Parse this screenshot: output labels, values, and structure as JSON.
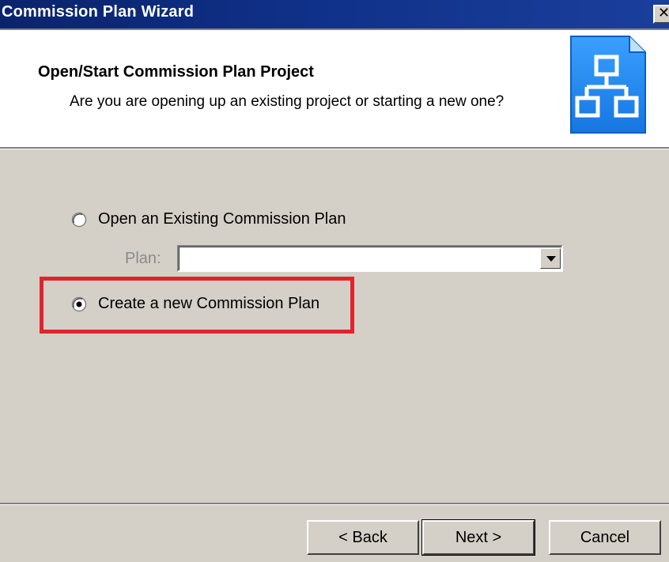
{
  "window": {
    "title": "Commission Plan Wizard",
    "close_glyph": "✕"
  },
  "header": {
    "title": "Open/Start Commission Plan Project",
    "subtitle": "Are you are opening up an existing project or starting a new one?",
    "icon": "org-chart-icon"
  },
  "options": {
    "open_existing": {
      "label": "Open an Existing Commission Plan",
      "selected": false
    },
    "plan_label": "Plan:",
    "plan_value": "",
    "create_new": {
      "label": "Create a new Commission Plan",
      "selected": true
    }
  },
  "buttons": {
    "back": "< Back",
    "next": "Next >",
    "cancel": "Cancel"
  },
  "colors": {
    "titlebar": "#0a246a",
    "dialog_bg": "#d4d0c8",
    "highlight": "#e0242c",
    "icon_blue": "#1e90ff"
  }
}
